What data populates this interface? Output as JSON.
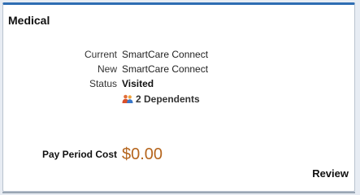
{
  "card": {
    "title": "Medical",
    "rows": [
      {
        "label": "Current",
        "value": "SmartCare Connect"
      },
      {
        "label": "New",
        "value": "SmartCare Connect"
      },
      {
        "label": "Status",
        "value": "Visited"
      }
    ],
    "dependents": "2 Dependents",
    "dependents_icon": "people-icon",
    "pay_period_label": "Pay Period Cost",
    "pay_period_value": "$0.00",
    "review_label": "Review"
  },
  "colors": {
    "accent": "#2e6db3",
    "cost": "#b5651d"
  }
}
